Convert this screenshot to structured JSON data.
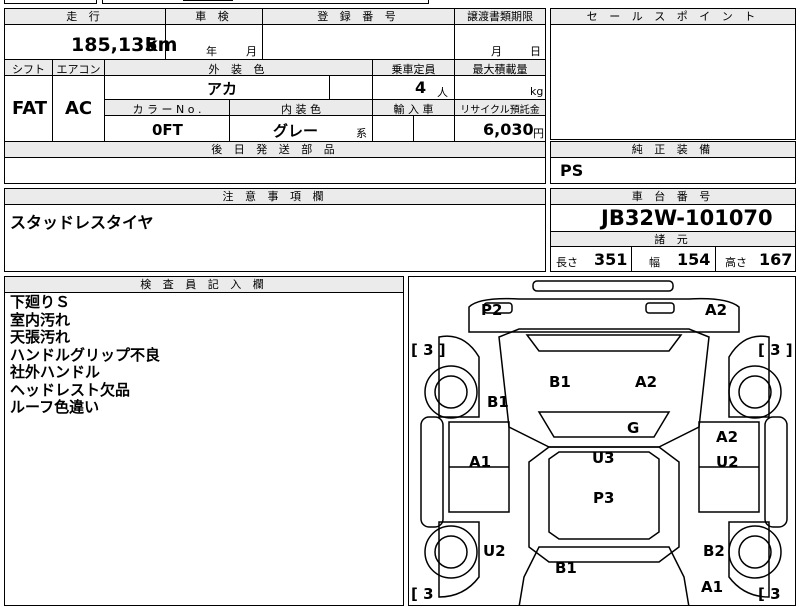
{
  "main_table": {
    "mileage_label": "走 行",
    "mileage_value": "185,135",
    "mileage_unit": "km",
    "inspection_label": "車 検",
    "inspection_year_unit": "年",
    "inspection_month_unit": "月",
    "registration_label": "登 録 番 号",
    "transfer_label": "譲渡書類期限",
    "transfer_month_unit": "月",
    "transfer_day_unit": "日",
    "shift_label": "シフト",
    "shift_value": "FAT",
    "ac_label": "エアコン",
    "ac_value": "AC",
    "exterior_color_label": "外 装 色",
    "exterior_color_value": "アカ",
    "capacity_label": "乗車定員",
    "capacity_value": "4",
    "capacity_unit": "人",
    "max_load_label": "最大積載量",
    "max_load_unit": "kg",
    "color_no_label": "カ ラ ー N o .",
    "color_no_value": "0FT",
    "interior_color_label": "内 装 色",
    "interior_color_value": "グレー",
    "interior_color_suffix": "系",
    "import_label": "輸 入 車",
    "recycle_label": "リサイクル預託金",
    "recycle_value": "6,030",
    "recycle_unit": "円",
    "later_parts_label": "後 日 発 送 部 品"
  },
  "sales_point": {
    "label": "セ ー ル ス ポ イ ン ト"
  },
  "genuine_equipment": {
    "label": "純 正 装 備",
    "value": "PS"
  },
  "caution": {
    "label": "注 意 事 項 欄",
    "text": "スタッドレスタイヤ"
  },
  "chassis": {
    "label": "車 台 番 号",
    "value": "JB32W-101070",
    "specs_label": "諸 元",
    "length_label": "長さ",
    "length_value": "351",
    "width_label": "幅",
    "width_value": "154",
    "height_label": "高さ",
    "height_value": "167"
  },
  "inspector": {
    "label": "検 査 員 記 入 欄",
    "notes": [
      "下廻りＳ",
      "室内汚れ",
      "天張汚れ",
      "ハンドルグリップ不良",
      "社外ハンドル",
      "ヘッドレスト欠品",
      "ルーフ色違い"
    ]
  },
  "diagram": {
    "tire_tl": "[ 3 ]",
    "tire_tr": "[ 3 ]",
    "tire_bl": "[ 3",
    "tire_br": "[ 3",
    "marks": {
      "front_left_door": "P2",
      "front_right_door": "A2",
      "hood_left": "B1",
      "hood_right": "A2",
      "left_fender": "B1",
      "center": "G",
      "left_door": "A1",
      "right_door_top": "A2",
      "right_door_bottom": "U2",
      "roof": "U3",
      "rear_panel": "P3",
      "left_rear": "U2",
      "right_rear": "B2",
      "rear_bottom": "B1",
      "rear_right": "A1"
    }
  }
}
